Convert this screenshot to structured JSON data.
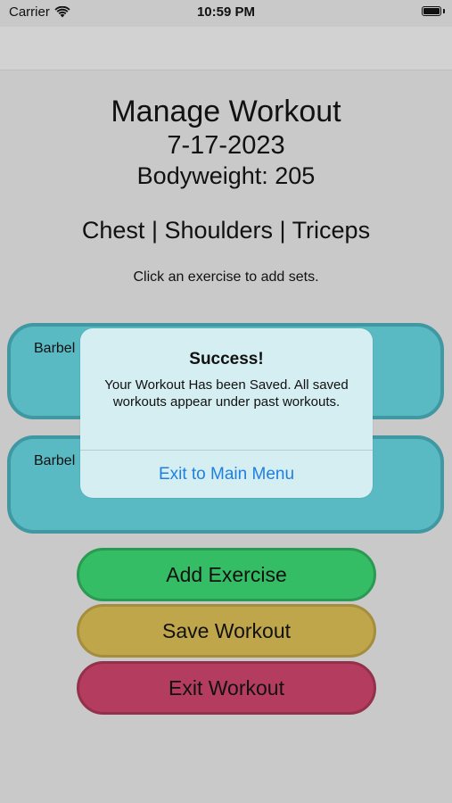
{
  "status_bar": {
    "carrier": "Carrier",
    "time": "10:59 PM"
  },
  "workout": {
    "title": "Manage Workout",
    "date": "7-17-2023",
    "bodyweight": "Bodyweight: 205",
    "muscle_groups": "Chest | Shoulders | Triceps",
    "hint": "Click an exercise to add sets."
  },
  "exercises": [
    {
      "name": "Barbel"
    },
    {
      "name": "Barbel"
    }
  ],
  "buttons": {
    "add_exercise": "Add Exercise",
    "save_workout": "Save Workout",
    "exit_workout": "Exit Workout"
  },
  "alert": {
    "title": "Success!",
    "message": "Your Workout Has been Saved. All saved workouts appear under past workouts.",
    "action": "Exit to Main Menu"
  },
  "colors": {
    "background": "#c9c9c9",
    "card": "#5abac4",
    "add_button": "#34bd64",
    "save_button": "#bfa64a",
    "exit_button": "#b43c5e",
    "alert_background": "#d5eef1",
    "alert_action": "#1f80e0"
  },
  "icons": {
    "signal": "wifi-icon",
    "power": "battery-icon"
  },
  "battery_level": 1.0
}
